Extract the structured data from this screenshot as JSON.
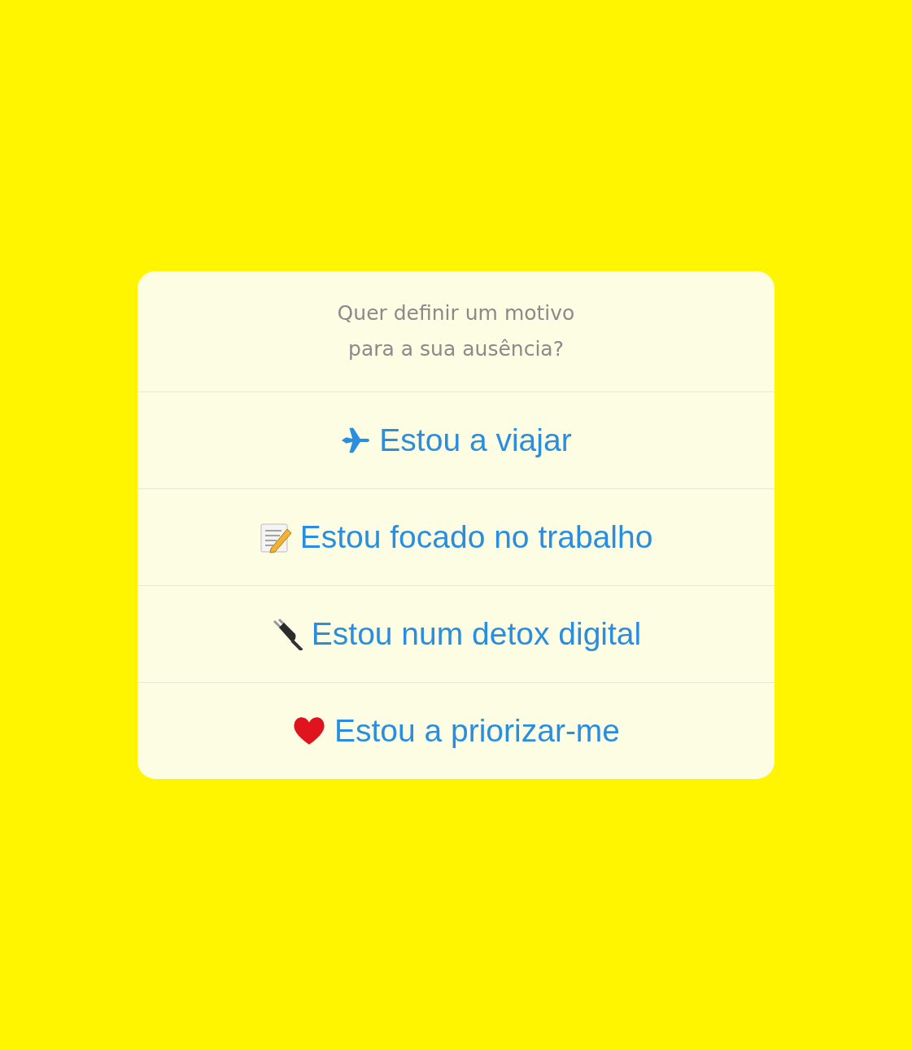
{
  "prompt": "Quer definir um motivo para a sua ausência?",
  "options": [
    {
      "kind": "plane",
      "label": "Estou a viajar"
    },
    {
      "kind": "memo",
      "label": "Estou focado no trabalho"
    },
    {
      "kind": "plug",
      "label": "Estou num detox digital"
    },
    {
      "kind": "heart",
      "label": "Estou a priorizar-me"
    }
  ]
}
